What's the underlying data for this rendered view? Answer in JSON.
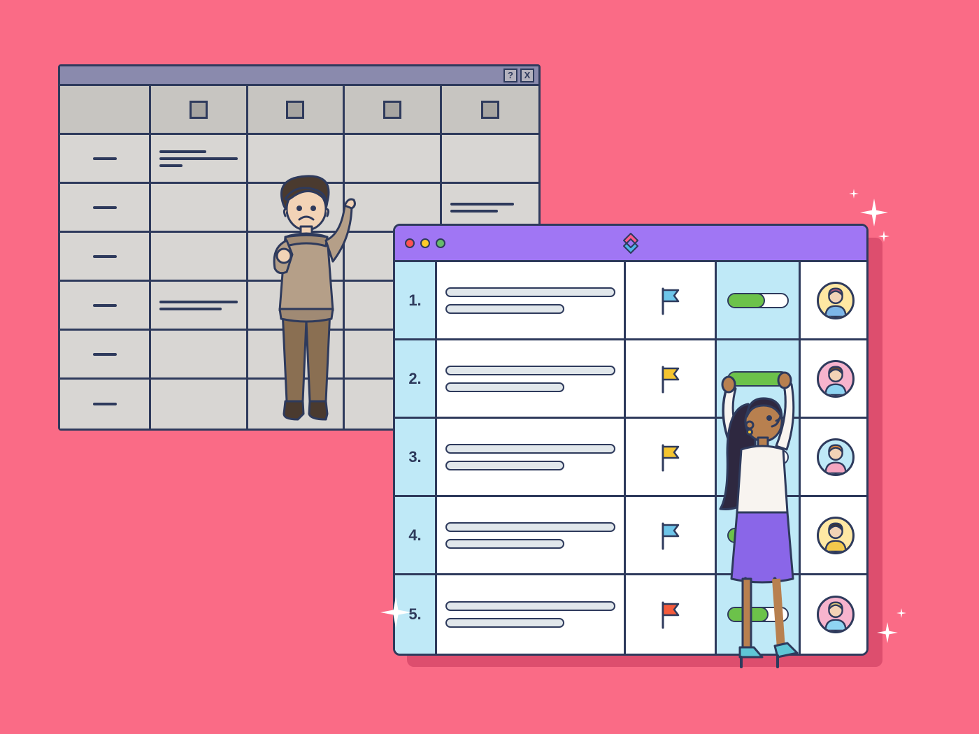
{
  "old_window": {
    "titlebar": {
      "help_btn": "?",
      "close_btn": "X"
    }
  },
  "new_window": {
    "rows": [
      {
        "num": "1.",
        "flag_color": "#6ec5e9",
        "progress": 55,
        "avatar": {
          "bg": "#ffe8a3",
          "hair": "#b85c7a",
          "shirt": "#7db6e8"
        }
      },
      {
        "num": "2.",
        "flag_color": "#f4c430",
        "progress": 100,
        "avatar": {
          "bg": "#f7b4cd",
          "hair": "#6a4a2f",
          "shirt": "#8fd4f2"
        }
      },
      {
        "num": "3.",
        "flag_color": "#f4c430",
        "progress": 50,
        "avatar": {
          "bg": "#bfe9f7",
          "hair": "#e88a3c",
          "shirt": "#f4a6c0"
        }
      },
      {
        "num": "4.",
        "flag_color": "#6ec5e9",
        "progress": 45,
        "avatar": {
          "bg": "#ffe8a3",
          "hair": "#3a3330",
          "shirt": "#f2c94c"
        }
      },
      {
        "num": "5.",
        "flag_color": "#f45b3c",
        "progress": 62,
        "avatar": {
          "bg": "#f7b4cd",
          "hair": "#e8d07a",
          "shirt": "#8fd4f2"
        }
      }
    ]
  }
}
